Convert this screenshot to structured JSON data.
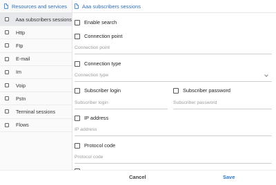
{
  "left": {
    "header": "Resources and services",
    "items": [
      "Aaa subscribers sessions",
      "Http",
      "Ftp",
      "E-mail",
      "Im",
      "Voip",
      "Pstn",
      "Terminal sessions",
      "Flows"
    ]
  },
  "right": {
    "header": "Aaa subscribers sessions",
    "enable_search": "Enable search",
    "connection_point": {
      "label": "Connection point",
      "placeholder": "Connection point"
    },
    "connection_type": {
      "label": "Connection type",
      "placeholder": "Connection type"
    },
    "subscriber_login": {
      "label": "Subscriber login",
      "placeholder": "Subscriber login"
    },
    "subscriber_password": {
      "label": "Subscriber password",
      "placeholder": "Subscriber password"
    },
    "ip_address": {
      "label": "IP address",
      "placeholder": "IP address"
    },
    "protocol_code": {
      "label": "Protocol code",
      "placeholder": "Protocol code"
    }
  },
  "footer": {
    "cancel": "Cancel",
    "save": "Save"
  },
  "colors": {
    "accent": "#4a90e2",
    "link": "#2f6fb5",
    "selected_row": "#e6e8eb"
  },
  "icons": {
    "header": "document-icon",
    "checkbox": "checkbox-icon",
    "dropdown": "chevron-down-icon"
  }
}
